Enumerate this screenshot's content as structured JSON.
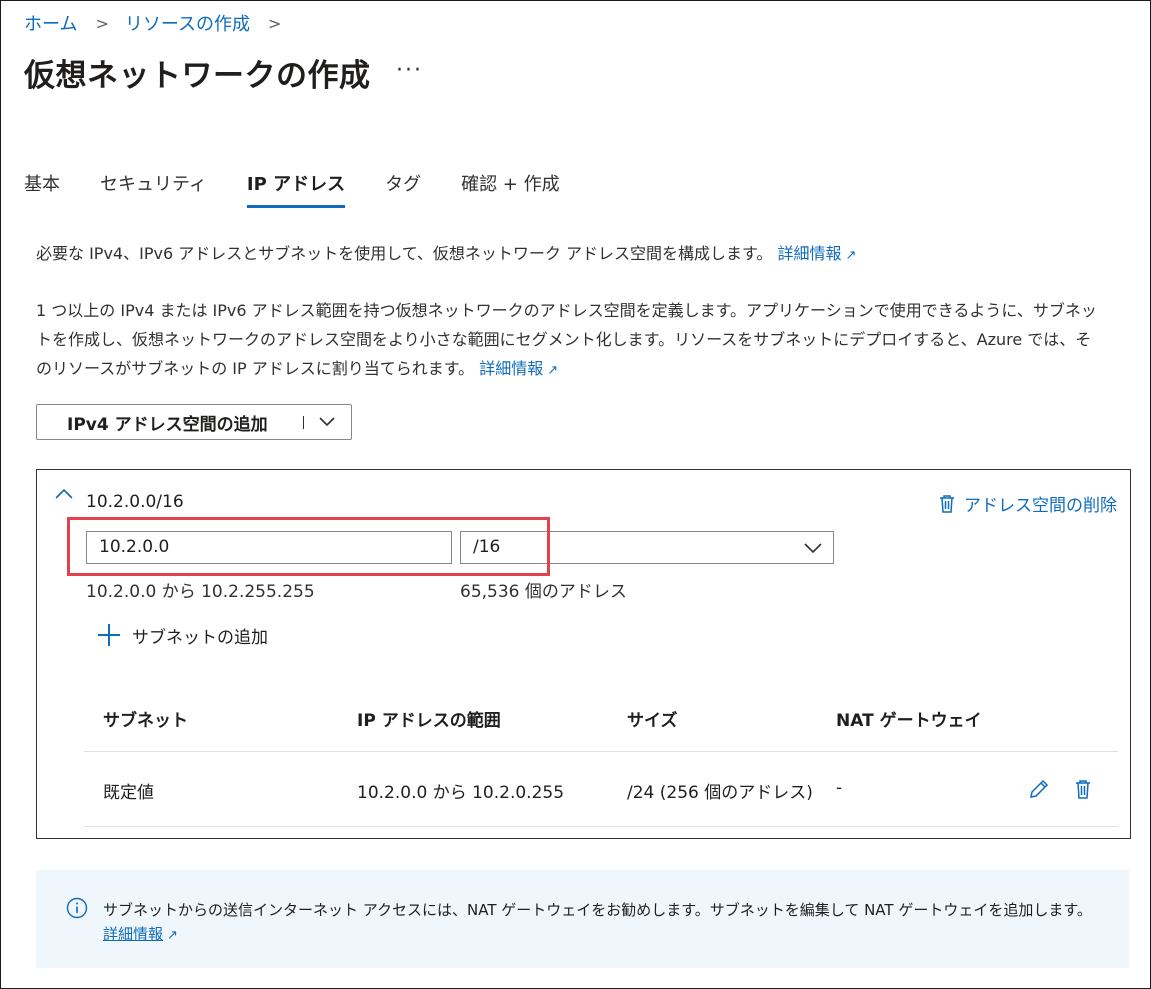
{
  "breadcrumb": {
    "home": "ホーム",
    "create_resource": "リソースの作成",
    "sep": ">"
  },
  "page": {
    "title": "仮想ネットワークの作成",
    "more": "···"
  },
  "tabs": [
    {
      "label": "基本"
    },
    {
      "label": "セキュリティ"
    },
    {
      "label": "IP アドレス"
    },
    {
      "label": "タグ"
    },
    {
      "label": "確認 + 作成"
    }
  ],
  "intro": {
    "text": "必要な IPv4、IPv6 アドレスとサブネットを使用して、仮想ネットワーク アドレス空間を構成します。",
    "link": "詳細情報"
  },
  "description": {
    "text": "1 つ以上の IPv4 または IPv6 アドレス範囲を持つ仮想ネットワークのアドレス空間を定義します。アプリケーションで使用できるように、サブネットを作成し、仮想ネットワークのアドレス空間をより小さな範囲にセグメント化します。リソースをサブネットにデプロイすると、Azure では、そのリソースがサブネットの IP アドレスに割り当てられます。",
    "link": "詳細情報"
  },
  "add_space_button": {
    "label": "IPv4 アドレス空間の追加"
  },
  "address_space": {
    "label": "10.2.0.0/16",
    "delete_label": "アドレス空間の削除",
    "address_value": "10.2.0.0",
    "prefix_value": "/16",
    "range_text": "10.2.0.0 から 10.2.255.255",
    "count_text": "65,536 個のアドレス",
    "add_subnet_label": "サブネットの追加"
  },
  "subnet_table": {
    "headers": [
      "サブネット",
      "IP アドレスの範囲",
      "サイズ",
      "NAT ゲートウェイ"
    ],
    "rows": [
      {
        "name": "既定値",
        "range": "10.2.0.0 から 10.2.0.255",
        "size": "/24 (256 個のアドレス)",
        "nat": "-"
      }
    ]
  },
  "info_banner": {
    "text": "サブネットからの送信インターネット アクセスには、NAT ゲートウェイをお勧めします。サブネットを編集して NAT ゲートウェイを追加します。",
    "link": "詳細情報"
  },
  "colors": {
    "accent": "#0f6cbd",
    "highlight": "#e3424d",
    "info_bg": "#eff6fc"
  }
}
